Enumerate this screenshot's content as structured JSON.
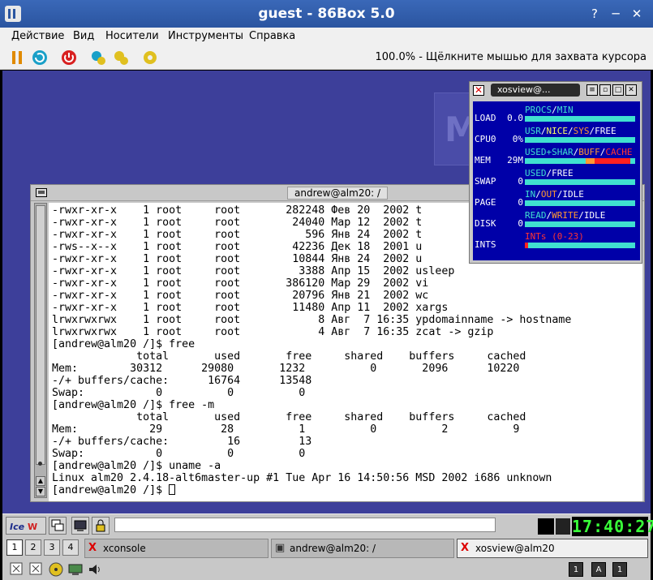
{
  "window": {
    "title": "guest - 86Box 5.0"
  },
  "menu": [
    "Действие",
    "Вид",
    "Носители",
    "Инструменты",
    "Справка"
  ],
  "status_text": "100.0% - Щёлкните мышью для захвата курсора",
  "xterm": {
    "title": "andrew@alm20: /",
    "lines": [
      "-rwxr-xr-x    1 root     root       282248 Фев 20  2002 t",
      "-rwxr-xr-x    1 root     root        24040 Мар 12  2002 t",
      "-rwxr-xr-x    1 root     root          596 Янв 24  2002 t",
      "-rws--x--x    1 root     root        42236 Дек 18  2001 u",
      "-rwxr-xr-x    1 root     root        10844 Янв 24  2002 u",
      "-rwxr-xr-x    1 root     root         3388 Апр 15  2002 usleep",
      "-rwxr-xr-x    1 root     root       386120 Мар 29  2002 vi",
      "-rwxr-xr-x    1 root     root        20796 Янв 21  2002 wc",
      "-rwxr-xr-x    1 root     root        11480 Апр 11  2002 xargs",
      "lrwxrwxrwx    1 root     root            8 Авг  7 16:35 ypdomainname -> hostname",
      "lrwxrwxrwx    1 root     root            4 Авг  7 16:35 zcat -> gzip",
      "[andrew@alm20 /]$ free",
      "             total       used       free     shared    buffers     cached",
      "Mem:        30312      29080       1232          0       2096      10220",
      "-/+ buffers/cache:      16764      13548",
      "Swap:           0          0          0",
      "[andrew@alm20 /]$ free -m",
      "             total       used       free     shared    buffers     cached",
      "Mem:           29         28          1          0          2          9",
      "-/+ buffers/cache:         16         13",
      "Swap:           0          0          0",
      "[andrew@alm20 /]$ uname -a",
      "Linux alm20 2.4.18-alt6master-up #1 Tue Apr 16 14:50:56 MSD 2002 i686 unknown"
    ],
    "prompt": "[andrew@alm20 /]$ "
  },
  "xosview": {
    "title": "xosview@...",
    "rows": [
      {
        "label": "LOAD",
        "value": "0.0",
        "legend": [
          {
            "t": "PROCS",
            "c": "#40e0d0"
          },
          {
            "t": "/",
            "c": "#ffffff"
          },
          {
            "t": "MIN",
            "c": "#40e0d0"
          }
        ],
        "fill": 0.0
      },
      {
        "label": "CPU0",
        "value": "0%",
        "legend": [
          {
            "t": "USR",
            "c": "#40e0d0"
          },
          {
            "t": "/",
            "c": "#ffffff"
          },
          {
            "t": "NICE",
            "c": "#ffff66"
          },
          {
            "t": "/",
            "c": "#ffffff"
          },
          {
            "t": "SYS",
            "c": "#ff9933"
          },
          {
            "t": "/",
            "c": "#ffffff"
          },
          {
            "t": "FREE",
            "c": "#ffffff"
          }
        ],
        "fill": 0.0
      },
      {
        "label": "MEM",
        "value": "29M",
        "legend": [
          {
            "t": "USED+SHAR",
            "c": "#40e0d0"
          },
          {
            "t": "/",
            "c": "#ffffff"
          },
          {
            "t": "BUFF",
            "c": "#ff9933"
          },
          {
            "t": "/",
            "c": "#ffffff"
          },
          {
            "t": "CACHE",
            "c": "#ff3333"
          }
        ],
        "fill": 0.95
      },
      {
        "label": "SWAP",
        "value": "0",
        "legend": [
          {
            "t": "USED",
            "c": "#40e0d0"
          },
          {
            "t": "/",
            "c": "#ffffff"
          },
          {
            "t": "FREE",
            "c": "#ffffff"
          }
        ],
        "fill": 0.0
      },
      {
        "label": "PAGE",
        "value": "0",
        "legend": [
          {
            "t": "IN",
            "c": "#40e0d0"
          },
          {
            "t": "/",
            "c": "#ffffff"
          },
          {
            "t": "OUT",
            "c": "#ff9933"
          },
          {
            "t": "/",
            "c": "#ffffff"
          },
          {
            "t": "IDLE",
            "c": "#ffffff"
          }
        ],
        "fill": 0.0
      },
      {
        "label": "DISK",
        "value": "0",
        "legend": [
          {
            "t": "READ",
            "c": "#40e0d0"
          },
          {
            "t": "/",
            "c": "#ffffff"
          },
          {
            "t": "WRITE",
            "c": "#ff9933"
          },
          {
            "t": "/",
            "c": "#ffffff"
          },
          {
            "t": "IDLE",
            "c": "#ffffff"
          }
        ],
        "fill": 0.0
      },
      {
        "label": "INTS",
        "value": "",
        "legend": [
          {
            "t": "INTs (0-23)",
            "c": "#ff3333"
          }
        ],
        "fill": 0.03
      }
    ]
  },
  "panel": {
    "clock": "17:40:27",
    "desktops": [
      "1",
      "2",
      "3",
      "4"
    ],
    "tasks": [
      "xconsole",
      "andrew@alm20: /",
      "xosview@alm20"
    ],
    "keyboard_indicators": [
      "1",
      "A",
      "1"
    ]
  }
}
